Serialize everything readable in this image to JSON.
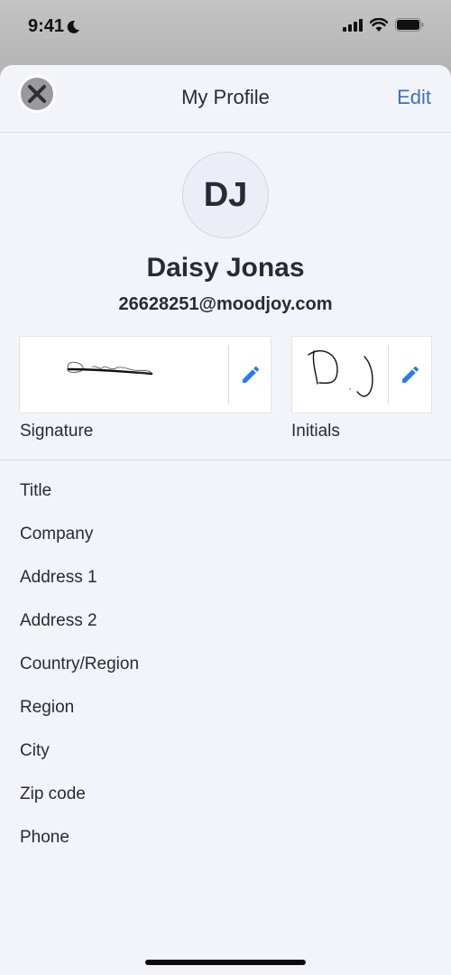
{
  "status_bar": {
    "time": "9:41",
    "icons": [
      "moon-icon",
      "cellular-signal-icon",
      "wifi-icon",
      "battery-icon"
    ]
  },
  "nav": {
    "close_icon": "close-icon",
    "title": "My Profile",
    "edit_label": "Edit"
  },
  "profile": {
    "initials": "DJ",
    "name": "Daisy Jonas",
    "email": "26628251@moodjoy.com"
  },
  "signature": {
    "label": "Signature",
    "edit_icon": "pencil-icon"
  },
  "initials_box": {
    "label": "Initials",
    "edit_icon": "pencil-icon"
  },
  "fields": [
    {
      "label": "Title"
    },
    {
      "label": "Company"
    },
    {
      "label": "Address 1"
    },
    {
      "label": "Address 2"
    },
    {
      "label": "Country/Region"
    },
    {
      "label": "Region"
    },
    {
      "label": "City"
    },
    {
      "label": "Zip code"
    },
    {
      "label": "Phone"
    }
  ],
  "colors": {
    "accent": "#3b6fc4",
    "pencil": "#2a7de1",
    "sheet_bg": "#f3f4f9",
    "text": "#262b36"
  }
}
